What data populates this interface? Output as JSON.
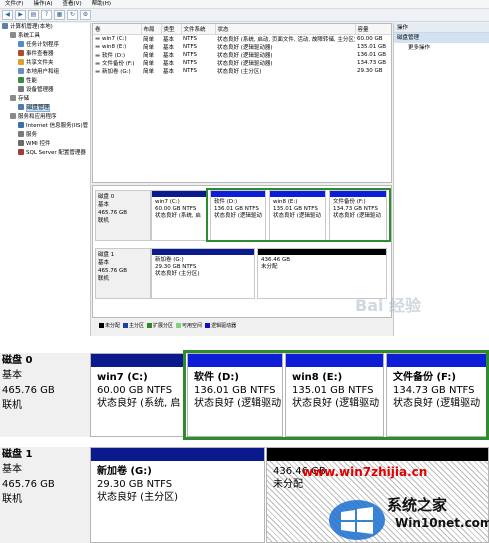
{
  "menu": [
    "文件(F)",
    "操作(A)",
    "查看(V)",
    "帮助(H)"
  ],
  "toolbar_icons": [
    "back-icon",
    "forward-icon",
    "pane-icon",
    "help-icon",
    "properties-icon",
    "refresh-icon",
    "settings-icon"
  ],
  "tree": [
    {
      "label": "计算机管理(本地)",
      "indent": 0,
      "color": "#5b7fa8"
    },
    {
      "label": "系统工具",
      "indent": 1,
      "color": "#8a8a8a"
    },
    {
      "label": "任务计划程序",
      "indent": 2,
      "color": "#4e8ecf"
    },
    {
      "label": "事件查看器",
      "indent": 2,
      "color": "#b04c2e"
    },
    {
      "label": "共享文件夹",
      "indent": 2,
      "color": "#d6a52a"
    },
    {
      "label": "本地用户和组",
      "indent": 2,
      "color": "#6b8ebd"
    },
    {
      "label": "性能",
      "indent": 2,
      "color": "#3c8c3c"
    },
    {
      "label": "设备管理器",
      "indent": 2,
      "color": "#7a7a7a"
    },
    {
      "label": "存储",
      "indent": 1,
      "color": "#8a8a8a"
    },
    {
      "label": "磁盘管理",
      "indent": 2,
      "color": "#4f79b0",
      "selected": true
    },
    {
      "label": "服务和应用程序",
      "indent": 1,
      "color": "#8a8a8a"
    },
    {
      "label": "Internet 信息服务(IIS)管",
      "indent": 2,
      "color": "#3a6fb0"
    },
    {
      "label": "服务",
      "indent": 2,
      "color": "#7a7a7a"
    },
    {
      "label": "WMI 控件",
      "indent": 2,
      "color": "#6a6a6a"
    },
    {
      "label": "SQL Server 配置管理器",
      "indent": 2,
      "color": "#a33a3a"
    }
  ],
  "volume_table": {
    "columns": [
      "卷",
      "布局",
      "类型",
      "文件系统",
      "状态",
      "容量"
    ],
    "rows": [
      [
        "win7 (C:)",
        "简单",
        "基本",
        "NTFS",
        "状态良好 (系统, 启动, 页面文件, 活动, 故障转储, 主分区)",
        "60.00 GB"
      ],
      [
        "win8 (E:)",
        "简单",
        "基本",
        "NTFS",
        "状态良好 (逻辑驱动器)",
        "135.01 GB"
      ],
      [
        "软件 (D:)",
        "简单",
        "基本",
        "NTFS",
        "状态良好 (逻辑驱动器)",
        "136.01 GB"
      ],
      [
        "文件备份 (F:)",
        "简单",
        "基本",
        "NTFS",
        "状态良好 (逻辑驱动器)",
        "134.73 GB"
      ],
      [
        "新加卷 (G:)",
        "简单",
        "基本",
        "NTFS",
        "状态良好 (主分区)",
        "29.30 GB"
      ]
    ]
  },
  "actions": {
    "header": "操作",
    "group": "磁盘管理",
    "item": "更多操作"
  },
  "disks": [
    {
      "name": "磁盘 0",
      "type": "基本",
      "size": "465.76 GB",
      "status": "联机",
      "partitions": [
        {
          "title": "win7 (C:)",
          "size": "60.00 GB NTFS",
          "status": "状态良好 (系统, 启",
          "kind": "primary"
        },
        {
          "title": "软件 (D:)",
          "size": "136.01 GB NTFS",
          "status": "状态良好 (逻辑驱动",
          "kind": "logical"
        },
        {
          "title": "win8 (E:)",
          "size": "135.01 GB NTFS",
          "status": "状态良好 (逻辑驱动",
          "kind": "logical"
        },
        {
          "title": "文件备份 (F:)",
          "size": "134.73 GB NTFS",
          "status": "状态良好 (逻辑驱动",
          "kind": "logical"
        }
      ]
    },
    {
      "name": "磁盘 1",
      "type": "基本",
      "size": "465.76 GB",
      "status": "联机",
      "partitions": [
        {
          "title": "新加卷 (G:)",
          "size": "29.30 GB NTFS",
          "status": "状态良好 (主分区)",
          "kind": "primary"
        },
        {
          "title": "",
          "size": "436.46 GB",
          "status": "未分配",
          "kind": "unallocated"
        }
      ]
    }
  ],
  "legend": [
    {
      "label": "未分配",
      "color": "#000000"
    },
    {
      "label": "主分区",
      "color": "#1f3fa8"
    },
    {
      "label": "扩展分区",
      "color": "#2a8a2a"
    },
    {
      "label": "可用空间",
      "color": "#7fd37f"
    },
    {
      "label": "逻辑驱动器",
      "color": "#1010c8"
    }
  ],
  "colors": {
    "primary": "#0a1a8c",
    "logical": "#0d1ed6",
    "unallocated": "#000000",
    "extended": "#2e8b2e"
  },
  "watermarks": {
    "baidu": "Bai 经验",
    "site1": "www.win7zhijia.cn",
    "brand": "系统之家",
    "site2": "Win10net.com"
  }
}
